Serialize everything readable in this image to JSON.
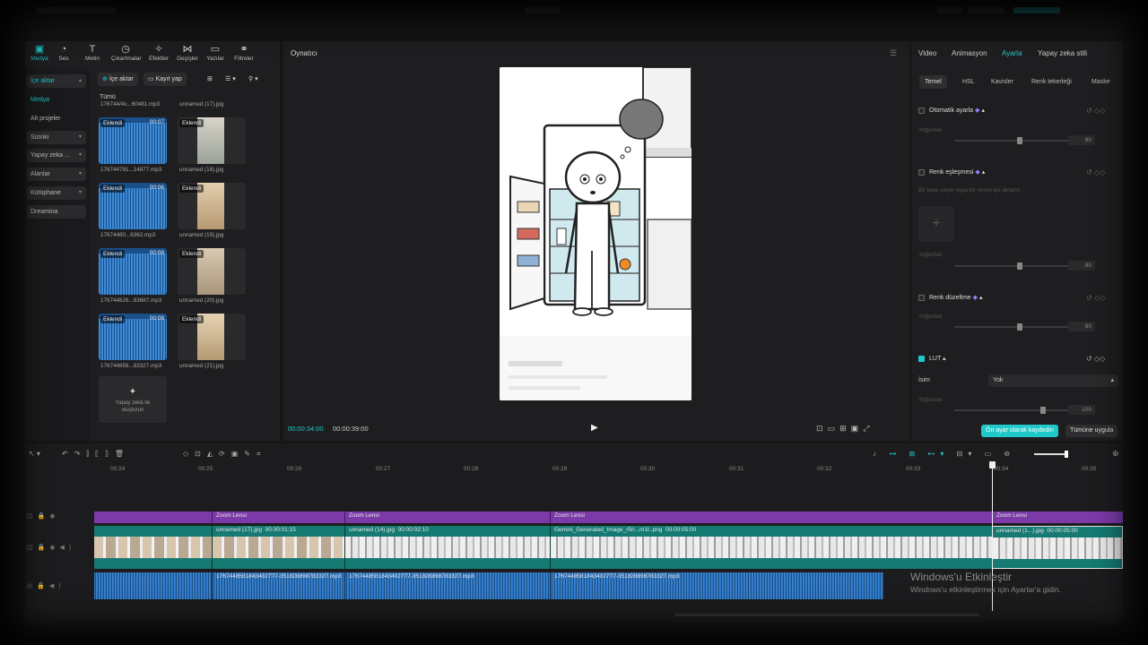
{
  "toolbar": {
    "items": [
      {
        "label": "Medya",
        "icon": "media-icon",
        "active": true
      },
      {
        "label": "Ses",
        "icon": "audio-icon"
      },
      {
        "label": "Metin",
        "icon": "text-icon"
      },
      {
        "label": "Çıkartmalar",
        "icon": "sticker-icon"
      },
      {
        "label": "Efektler",
        "icon": "effects-icon"
      },
      {
        "label": "Geçişler",
        "icon": "transition-icon"
      },
      {
        "label": "Yazılar",
        "icon": "captions-icon"
      },
      {
        "label": "Filtreler",
        "icon": "filter-icon"
      }
    ]
  },
  "sidebar": {
    "items": [
      {
        "label": "İçe aktar",
        "chev": "▴",
        "hl": true,
        "color": "#20c9c9"
      },
      {
        "label": "Medya",
        "chev": "",
        "color": "#20c9c9"
      },
      {
        "label": "Alt projeler",
        "chev": ""
      },
      {
        "label": "Sizinki",
        "chev": "▾",
        "hl": true
      },
      {
        "label": "Yapay zeka ...",
        "chev": "▾",
        "hl": true
      },
      {
        "label": "Alanlar",
        "chev": "▾",
        "hl": true
      },
      {
        "label": "Kütüphane",
        "chev": "▾",
        "hl": true
      },
      {
        "label": "Dreamina",
        "chev": "",
        "hl": true
      }
    ]
  },
  "media": {
    "import_label": "İçe aktar",
    "record_label": "Kayıt yap",
    "filter_label": "Tümü",
    "partial_top_left": "176744/4x...60481.mp3",
    "partial_top_right": "unnamed (17).jpg",
    "added": "Eklendi",
    "items": [
      {
        "type": "audio",
        "duration": "00:07",
        "name": "176744791...14877.mp3"
      },
      {
        "type": "image",
        "name": "unnamed (18).jpg"
      },
      {
        "type": "audio",
        "duration": "00:06",
        "name": "17674480...6362.mp3"
      },
      {
        "type": "image",
        "name": "unnamed (19).jpg"
      },
      {
        "type": "audio",
        "duration": "00:08",
        "name": "176744826...63687.mp3"
      },
      {
        "type": "image",
        "name": "unnamed (20).jpg"
      },
      {
        "type": "audio",
        "duration": "00:08",
        "name": "176744858...83327.mp3"
      },
      {
        "type": "image",
        "name": "unnamed (21).jpg"
      }
    ],
    "ai_label": "Yapay zekâ ile oluşturun"
  },
  "player": {
    "title": "Oynatıcı",
    "current_time": "00:00:34:00",
    "total_time": "00:00:39:00"
  },
  "right": {
    "tabs": [
      "Video",
      "Animasyon",
      "Ayarla",
      "Yapay zeka stili"
    ],
    "active_tab": "Ayarla",
    "subtabs": [
      "Temel",
      "HSL",
      "Kavisler",
      "Renk tekerleği",
      "Maske"
    ],
    "sections": {
      "auto_adjust": "Otomatik ayarla",
      "color_match": "Renk eşleşmesi",
      "color_match_hint": "Bir kare seçin veya bir resmi içe aktarın.",
      "color_correction": "Renk düzeltme",
      "lut": "LUT",
      "name_label": "İsim",
      "name_value": "Yok",
      "intensity": "Yoğunluk",
      "val80": "80",
      "val100": "100"
    },
    "save_preset": "Ön ayar olarak kaydedin",
    "apply_all": "Tümüne uygula"
  },
  "timeline": {
    "ticks": [
      "00:24",
      "00:25",
      "00:26",
      "00:27",
      "00:28",
      "00:29",
      "00:30",
      "00:31",
      "00:32",
      "00:33",
      "00:34",
      "00:35"
    ],
    "effect_label": "Zoom Lensi",
    "clips": [
      {
        "name": "unnamed (17).jpg",
        "dur": "00:00:01:15"
      },
      {
        "name": "unnamed (14).jpg",
        "dur": "00:00:02:10"
      },
      {
        "name": "Gemini_Generated_Image_r5ri...m1t..png",
        "dur": "00:00:05:00"
      },
      {
        "name": "unnamed (1...).jpg",
        "dur": "00:00:05:00"
      }
    ],
    "audio_name": "1767448581843402777-351828898783327.mp3"
  },
  "watermark": {
    "title": "Windows'u Etkinleştir",
    "sub": "Windows'u etkinleştirmek için Ayarlar'a gidin."
  },
  "colors": {
    "accent": "#20c9c9",
    "effect": "#7b3aa8",
    "video_track": "#147a72",
    "audio": "#1b5590"
  }
}
